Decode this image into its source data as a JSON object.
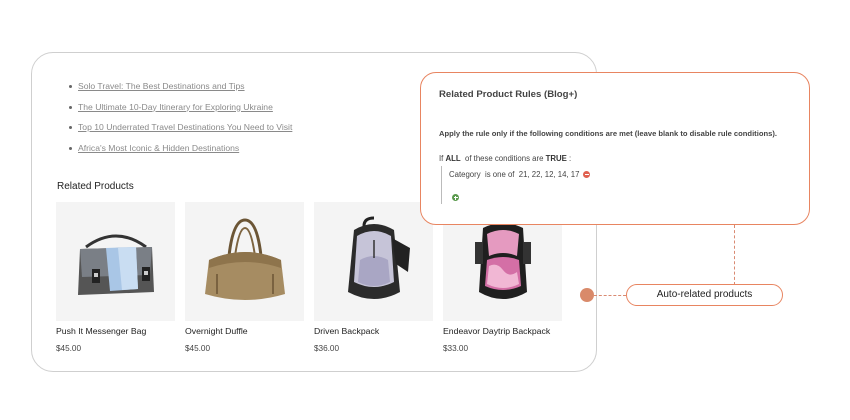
{
  "blog_links": [
    "Solo Travel: The Best Destinations and Tips",
    "The Ultimate 10-Day Itinerary for Exploring Ukraine",
    "Top 10 Underrated Travel Destinations You Need to Visit",
    "Africa's Most Iconic & Hidden Destinations"
  ],
  "related_products": {
    "heading": "Related Products",
    "items": [
      {
        "name": "Push It Messenger Bag",
        "price": "$45.00"
      },
      {
        "name": "Overnight Duffle",
        "price": "$45.00"
      },
      {
        "name": "Driven Backpack",
        "price": "$36.00"
      },
      {
        "name": "Endeavor Daytrip Backpack",
        "price": "$33.00"
      }
    ]
  },
  "rules_panel": {
    "title": "Related Product Rules (Blog+)",
    "description": "Apply the rule only if the following conditions are met (leave blank to disable rule conditions).",
    "if_prefix": "If ",
    "if_all": "ALL",
    "if_middle": "  of these conditions are ",
    "if_true": "TRUE",
    "if_suffix": " :",
    "condition_attr": "Category",
    "condition_op": "  is one of  ",
    "condition_value": "21, 22, 12, 14, 17"
  },
  "callout": {
    "label": "Auto-related products"
  },
  "colors": {
    "accent": "#e88561",
    "callout_dot": "#d98a6a",
    "remove_icon": "#e0604f",
    "add_icon": "#5a9a4d"
  }
}
